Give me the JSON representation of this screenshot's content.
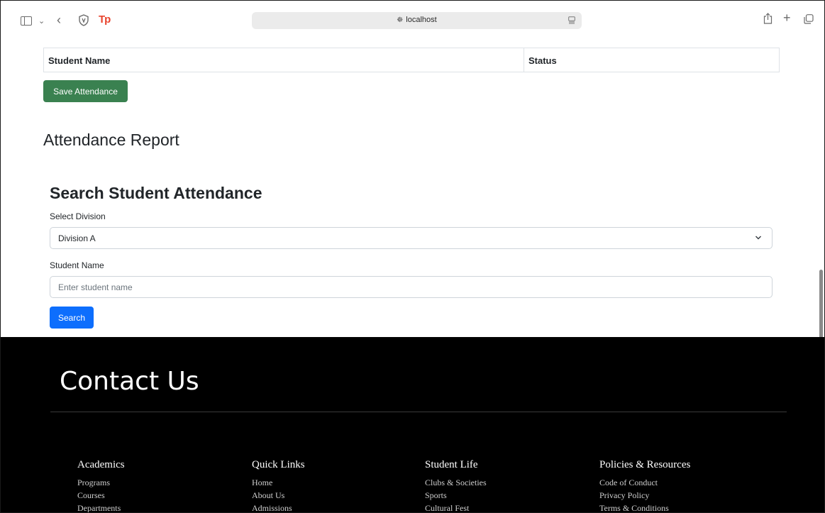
{
  "browser": {
    "url": "localhost",
    "tp_logo": "Tp"
  },
  "table": {
    "headers": [
      "Student Name",
      "Status"
    ]
  },
  "save_button": "Save Attendance",
  "report_title": "Attendance Report",
  "search": {
    "title": "Search Student Attendance",
    "division_label": "Select Division",
    "division_value": "Division A",
    "student_label": "Student Name",
    "student_placeholder": "Enter student name",
    "button": "Search"
  },
  "footer": {
    "title": "Contact Us",
    "columns": [
      {
        "heading": "Academics",
        "links": [
          "Programs",
          "Courses",
          "Departments"
        ]
      },
      {
        "heading": "Quick Links",
        "links": [
          "Home",
          "About Us",
          "Admissions"
        ]
      },
      {
        "heading": "Student Life",
        "links": [
          "Clubs & Societies",
          "Sports",
          "Cultural Fest"
        ]
      },
      {
        "heading": "Policies & Resources",
        "links": [
          "Code of Conduct",
          "Privacy Policy",
          "Terms & Conditions"
        ]
      }
    ]
  },
  "colors": {
    "save_button": "#3a8150",
    "search_button": "#0d6efd",
    "footer_bg": "#000000"
  }
}
